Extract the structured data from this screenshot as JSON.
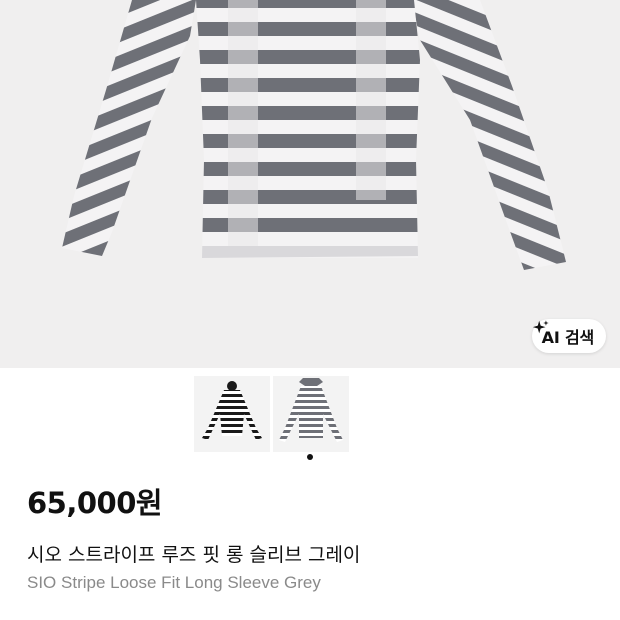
{
  "product": {
    "image_alt": "striped long sleeve top",
    "ai_search_label": "AI 검색",
    "thumbnails": [
      {
        "name": "thumbnail-black-stripe",
        "stripe_color": "#1a1a1a"
      },
      {
        "name": "thumbnail-grey-stripe",
        "stripe_color": "#6e7077"
      }
    ],
    "selected_thumbnail_index": 0,
    "price": "65,000원",
    "title_ko": "시오 스트라이프 루즈 핏 롱 슬리브 그레이",
    "title_en": "SIO Stripe Loose Fit Long Sleeve Grey"
  },
  "colors": {
    "background": "#f0efef",
    "stripe_dark": "#6e7077",
    "stripe_light": "#f4f3f4",
    "text_primary": "#111111",
    "text_secondary": "#8a8a8a"
  },
  "icons": {
    "ai_sparkle": "sparkle-icon"
  }
}
